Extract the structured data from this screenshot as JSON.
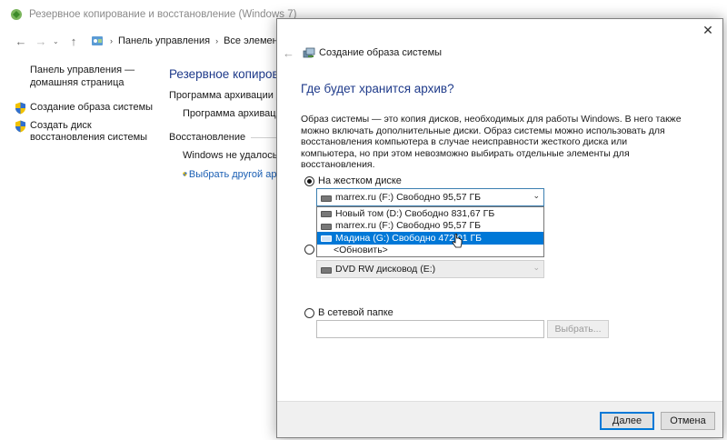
{
  "bg_window": {
    "title": "Резервное копирование и восстановление (Windows 7)",
    "nav": {
      "back": "←",
      "forward": "→",
      "recent": "⌄",
      "up": "↑"
    },
    "breadcrumb": [
      "Панель управления",
      "Все элементы пан"
    ],
    "left_pane": {
      "home_link": "Панель управления — домашняя страница",
      "links": [
        {
          "label": "Создание образа системы",
          "icon": "shield-icon"
        },
        {
          "label": "Создать диск восстановления системы",
          "icon": "shield-icon"
        }
      ]
    },
    "main": {
      "title": "Резервное копирова",
      "archive_heading": "Программа архивации данн",
      "archive_sub": "Программа архивации д",
      "restore_heading": "Восстановление",
      "restore_text": "Windows не удалось най",
      "restore_link": "Выбрать другой архи"
    }
  },
  "dialog": {
    "close": "✕",
    "back": "←",
    "header_title": "Создание образа системы",
    "heading": "Где будет хранится архив?",
    "description": "Образ системы — это копия дисков, необходимых для работы Windows. В него также можно включать дополнительные диски. Образ системы можно использовать для восстановления компьютера в случае неисправности жесткого диска или компьютера, но при этом невозможно выбирать отдельные элементы для восстановления.",
    "option_hdd": "На жестком диске",
    "option_dvd": "",
    "option_network": "В сетевой папке",
    "hdd_selected": "marrex.ru (F:)  Свободно 95,57 ГБ",
    "dropdown_items": [
      "Новый том (D:)  Свободно 831,67 ГБ",
      "marrex.ru (F:)  Свободно 95,57 ГБ",
      "Мадина (G:)  Свободно 472,01 ГБ"
    ],
    "dropdown_refresh": "<Обновить>",
    "dropdown_selected_index": 2,
    "dvd_value": "DVD RW дисковод (E:)",
    "network_value": "",
    "browse_label": "Выбрать...",
    "next_label": "Далее",
    "cancel_label": "Отмена"
  },
  "colors": {
    "accent": "#0078d7",
    "heading_blue": "#1e3a8a",
    "link_blue": "#1a5fb4"
  }
}
